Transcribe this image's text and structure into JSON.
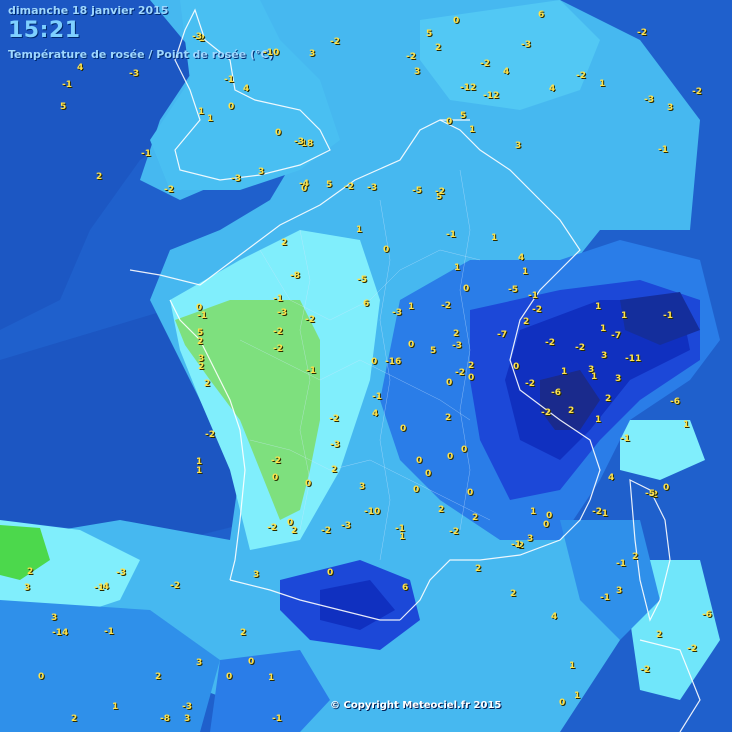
{
  "header": {
    "date": "dimanche 18 janvier 2015",
    "time": "15:21",
    "field": "Température de rosée / Point de rosée (°C)"
  },
  "footer": {
    "copyright": "© Copyright Meteociel.fr 2015"
  },
  "colors": {
    "sea_deep": "#1a56c6",
    "sea": "#1f66d8",
    "zone_0_to_4": "#46b8f0",
    "zone_4_plus": "#80f0ff",
    "zone_green": "#7ee07e",
    "zone_cold_1": "#2a7de8",
    "zone_cold_2": "#1c48d8",
    "zone_cold_3": "#1030c0",
    "zone_coldest": "#1a2a8c",
    "station_text": "#ffe24a"
  },
  "observations": [
    "1",
    "2",
    "0",
    "1",
    "2",
    "2",
    "0",
    "-2",
    "-2",
    "0",
    "0",
    "-2",
    "2",
    "2",
    "1",
    "2",
    "2",
    "-1",
    "-1",
    "0",
    "1",
    "1",
    "0",
    "1",
    "-2",
    "0",
    "1",
    "-2",
    "3",
    "1",
    "0",
    "0",
    "1",
    "1",
    "-4",
    "0",
    "-1",
    "-1",
    "-1",
    "-2",
    "0",
    "-2",
    "-2",
    "0",
    "0",
    "-1",
    "-2",
    "-3",
    "-2",
    "0",
    "-2",
    "0",
    "2",
    "2",
    "3",
    "1",
    "0",
    "0",
    "0",
    "-1",
    "0",
    "-1",
    "-2",
    "-3",
    "-2",
    "-4",
    "-2",
    "-2",
    "3",
    "3",
    "2",
    "1",
    "0",
    "-2",
    "-1",
    "-1",
    "0",
    "-2",
    "-1",
    "-3",
    "-1",
    "2",
    "1",
    "1",
    "0",
    "0",
    "2",
    "2",
    "3",
    "-2",
    "-3",
    "-2",
    "-1",
    "-3",
    "-2",
    "-6",
    "-2",
    "-8",
    "-5",
    "-10",
    "-12",
    "-2",
    "-1",
    "-16",
    "-6",
    "0",
    "1",
    "2",
    "3",
    "4",
    "4",
    "5",
    "2",
    "3",
    "3",
    "0",
    "-1",
    "-2",
    "-3",
    "-3",
    "-2",
    "-5",
    "-7",
    "-10",
    "2",
    "4",
    "5",
    "3",
    "1",
    "2",
    "0",
    "-1",
    "-3",
    "-3",
    "-6",
    "-18",
    "-12",
    "-8",
    "4",
    "5",
    "3",
    "2",
    "1",
    "3",
    "4",
    "5",
    "6",
    "2",
    "0",
    "1",
    "0",
    "-1",
    "-1",
    "-2",
    "-3",
    "-5",
    "-2",
    "-3",
    "1",
    "2",
    "3",
    "4",
    "5",
    "6",
    "5",
    "3",
    "2",
    "1",
    "0",
    "-1",
    "-2",
    "-3",
    "-2",
    "-2",
    "-1",
    "0",
    "1",
    "2",
    "3",
    "3",
    "4",
    "4",
    "1",
    "2",
    "-3",
    "-2",
    "0",
    "3",
    "1",
    "1",
    "3",
    "-5",
    "-2",
    "-7",
    "-11",
    "6",
    "-14",
    "-2",
    "-3",
    "5",
    "2"
  ]
}
